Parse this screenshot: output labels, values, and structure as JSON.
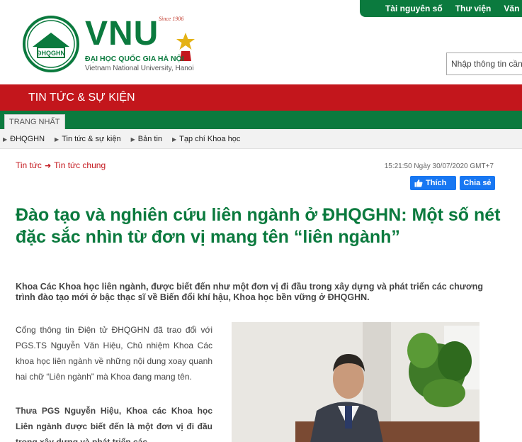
{
  "toplinks": {
    "items": [
      "Tài nguyên số",
      "Thư viện",
      "Văn bả"
    ]
  },
  "logo": {
    "since": "Since 1906",
    "vnu": "VNU",
    "seal_text": "ĐHQGHN",
    "vn_name": "ĐẠI HỌC QUỐC GIA HÀ NỘI",
    "en_name": "Vietnam National University, Hanoi"
  },
  "search": {
    "placeholder": "Nhập thông tin cần"
  },
  "section": {
    "title": "TIN TỨC & SỰ KIỆN"
  },
  "greennav": {
    "tab": "TRANG NHẤT"
  },
  "subnav": {
    "items": [
      "ĐHQGHN",
      "Tin tức & sự kiện",
      "Bản tin",
      "Tạp chí Khoa học"
    ]
  },
  "breadcrumb": {
    "root": "Tin tức",
    "current": "Tin tức chung"
  },
  "article": {
    "datetime": "15:21:50 Ngày 30/07/2020 GMT+7",
    "like_label": "Thích",
    "share_label": "Chia sẻ",
    "headline": "Đào tạo và nghiên cứu liên ngành ở ĐHQGHN: Một số nét đặc sắc nhìn từ đơn vị mang tên “liên ngành”",
    "sapo": "Khoa Các Khoa học liên ngành, được biết đến như một đơn vị đi đầu trong xây dựng và phát triển các chương trình đào tạo mới ở bậc thạc sĩ về Biến đổi khí hậu, Khoa học bền vững ở ĐHQGHN.",
    "para1": "Cổng thông tin Điện tử ĐHQGHN đã trao đổi với PGS.TS Nguyễn Văn Hiệu, Chủ nhiệm Khoa Các khoa học liên ngành về những nội dung xoay quanh hai chữ “Liên ngành” mà Khoa đang mang tên.",
    "para2": "Thưa PGS Nguyễn Hiệu, Khoa các Khoa học Liên ngành được biết đến là một đơn vị đi đầu trong xây dựng và phát triển các"
  },
  "colors": {
    "green": "#0b7a3e",
    "red": "#c3161c",
    "facebook": "#1877f2"
  }
}
